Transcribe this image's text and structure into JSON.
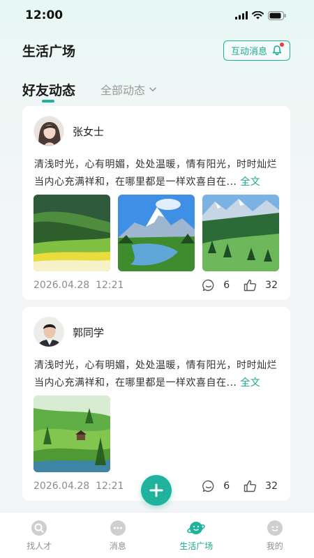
{
  "status_bar": {
    "time": "12:00"
  },
  "header": {
    "title": "生活广场",
    "message_button_label": "互动消息"
  },
  "tabs": {
    "active_label": "好友动态",
    "inactive_label": "全部动态"
  },
  "posts": [
    {
      "author": "张女士",
      "text": "清浅时光，心有明媚，处处温暖，情有阳光，时时灿烂当内心充满祥和，在哪里都是一样欢喜自在...",
      "full_text_label": "全文",
      "date": "2026.04.28",
      "time": "12:21",
      "comments": "6",
      "likes": "32"
    },
    {
      "author": "郭同学",
      "text": "清浅时光，心有明媚，处处温暖，情有阳光，时时灿烂当内心充满祥和，在哪里都是一样欢喜自在...",
      "full_text_label": "全文",
      "date": "2026.04.28",
      "time": "12:21",
      "comments": "6",
      "likes": "32"
    }
  ],
  "bottom_nav": {
    "items": [
      {
        "label": "找人才",
        "icon": "search-icon"
      },
      {
        "label": "消息",
        "icon": "chat-icon"
      },
      {
        "label": "生活广场",
        "icon": "planet-icon"
      },
      {
        "label": "我的",
        "icon": "profile-icon"
      }
    ],
    "active_index": 2
  },
  "colors": {
    "accent": "#1fb39d",
    "badge": "#f23b3b",
    "inactive_text": "#9a9a9a"
  }
}
